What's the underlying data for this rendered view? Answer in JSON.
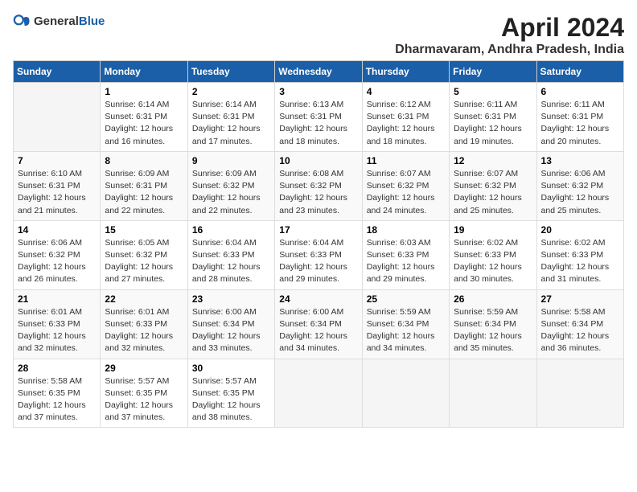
{
  "logo": {
    "general": "General",
    "blue": "Blue"
  },
  "title": "April 2024",
  "subtitle": "Dharmavaram, Andhra Pradesh, India",
  "headers": [
    "Sunday",
    "Monday",
    "Tuesday",
    "Wednesday",
    "Thursday",
    "Friday",
    "Saturday"
  ],
  "weeks": [
    [
      {
        "day": "",
        "info": ""
      },
      {
        "day": "1",
        "info": "Sunrise: 6:14 AM\nSunset: 6:31 PM\nDaylight: 12 hours\nand 16 minutes."
      },
      {
        "day": "2",
        "info": "Sunrise: 6:14 AM\nSunset: 6:31 PM\nDaylight: 12 hours\nand 17 minutes."
      },
      {
        "day": "3",
        "info": "Sunrise: 6:13 AM\nSunset: 6:31 PM\nDaylight: 12 hours\nand 18 minutes."
      },
      {
        "day": "4",
        "info": "Sunrise: 6:12 AM\nSunset: 6:31 PM\nDaylight: 12 hours\nand 18 minutes."
      },
      {
        "day": "5",
        "info": "Sunrise: 6:11 AM\nSunset: 6:31 PM\nDaylight: 12 hours\nand 19 minutes."
      },
      {
        "day": "6",
        "info": "Sunrise: 6:11 AM\nSunset: 6:31 PM\nDaylight: 12 hours\nand 20 minutes."
      }
    ],
    [
      {
        "day": "7",
        "info": "Sunrise: 6:10 AM\nSunset: 6:31 PM\nDaylight: 12 hours\nand 21 minutes."
      },
      {
        "day": "8",
        "info": "Sunrise: 6:09 AM\nSunset: 6:31 PM\nDaylight: 12 hours\nand 22 minutes."
      },
      {
        "day": "9",
        "info": "Sunrise: 6:09 AM\nSunset: 6:32 PM\nDaylight: 12 hours\nand 22 minutes."
      },
      {
        "day": "10",
        "info": "Sunrise: 6:08 AM\nSunset: 6:32 PM\nDaylight: 12 hours\nand 23 minutes."
      },
      {
        "day": "11",
        "info": "Sunrise: 6:07 AM\nSunset: 6:32 PM\nDaylight: 12 hours\nand 24 minutes."
      },
      {
        "day": "12",
        "info": "Sunrise: 6:07 AM\nSunset: 6:32 PM\nDaylight: 12 hours\nand 25 minutes."
      },
      {
        "day": "13",
        "info": "Sunrise: 6:06 AM\nSunset: 6:32 PM\nDaylight: 12 hours\nand 25 minutes."
      }
    ],
    [
      {
        "day": "14",
        "info": "Sunrise: 6:06 AM\nSunset: 6:32 PM\nDaylight: 12 hours\nand 26 minutes."
      },
      {
        "day": "15",
        "info": "Sunrise: 6:05 AM\nSunset: 6:32 PM\nDaylight: 12 hours\nand 27 minutes."
      },
      {
        "day": "16",
        "info": "Sunrise: 6:04 AM\nSunset: 6:33 PM\nDaylight: 12 hours\nand 28 minutes."
      },
      {
        "day": "17",
        "info": "Sunrise: 6:04 AM\nSunset: 6:33 PM\nDaylight: 12 hours\nand 29 minutes."
      },
      {
        "day": "18",
        "info": "Sunrise: 6:03 AM\nSunset: 6:33 PM\nDaylight: 12 hours\nand 29 minutes."
      },
      {
        "day": "19",
        "info": "Sunrise: 6:02 AM\nSunset: 6:33 PM\nDaylight: 12 hours\nand 30 minutes."
      },
      {
        "day": "20",
        "info": "Sunrise: 6:02 AM\nSunset: 6:33 PM\nDaylight: 12 hours\nand 31 minutes."
      }
    ],
    [
      {
        "day": "21",
        "info": "Sunrise: 6:01 AM\nSunset: 6:33 PM\nDaylight: 12 hours\nand 32 minutes."
      },
      {
        "day": "22",
        "info": "Sunrise: 6:01 AM\nSunset: 6:33 PM\nDaylight: 12 hours\nand 32 minutes."
      },
      {
        "day": "23",
        "info": "Sunrise: 6:00 AM\nSunset: 6:34 PM\nDaylight: 12 hours\nand 33 minutes."
      },
      {
        "day": "24",
        "info": "Sunrise: 6:00 AM\nSunset: 6:34 PM\nDaylight: 12 hours\nand 34 minutes."
      },
      {
        "day": "25",
        "info": "Sunrise: 5:59 AM\nSunset: 6:34 PM\nDaylight: 12 hours\nand 34 minutes."
      },
      {
        "day": "26",
        "info": "Sunrise: 5:59 AM\nSunset: 6:34 PM\nDaylight: 12 hours\nand 35 minutes."
      },
      {
        "day": "27",
        "info": "Sunrise: 5:58 AM\nSunset: 6:34 PM\nDaylight: 12 hours\nand 36 minutes."
      }
    ],
    [
      {
        "day": "28",
        "info": "Sunrise: 5:58 AM\nSunset: 6:35 PM\nDaylight: 12 hours\nand 37 minutes."
      },
      {
        "day": "29",
        "info": "Sunrise: 5:57 AM\nSunset: 6:35 PM\nDaylight: 12 hours\nand 37 minutes."
      },
      {
        "day": "30",
        "info": "Sunrise: 5:57 AM\nSunset: 6:35 PM\nDaylight: 12 hours\nand 38 minutes."
      },
      {
        "day": "",
        "info": ""
      },
      {
        "day": "",
        "info": ""
      },
      {
        "day": "",
        "info": ""
      },
      {
        "day": "",
        "info": ""
      }
    ]
  ]
}
